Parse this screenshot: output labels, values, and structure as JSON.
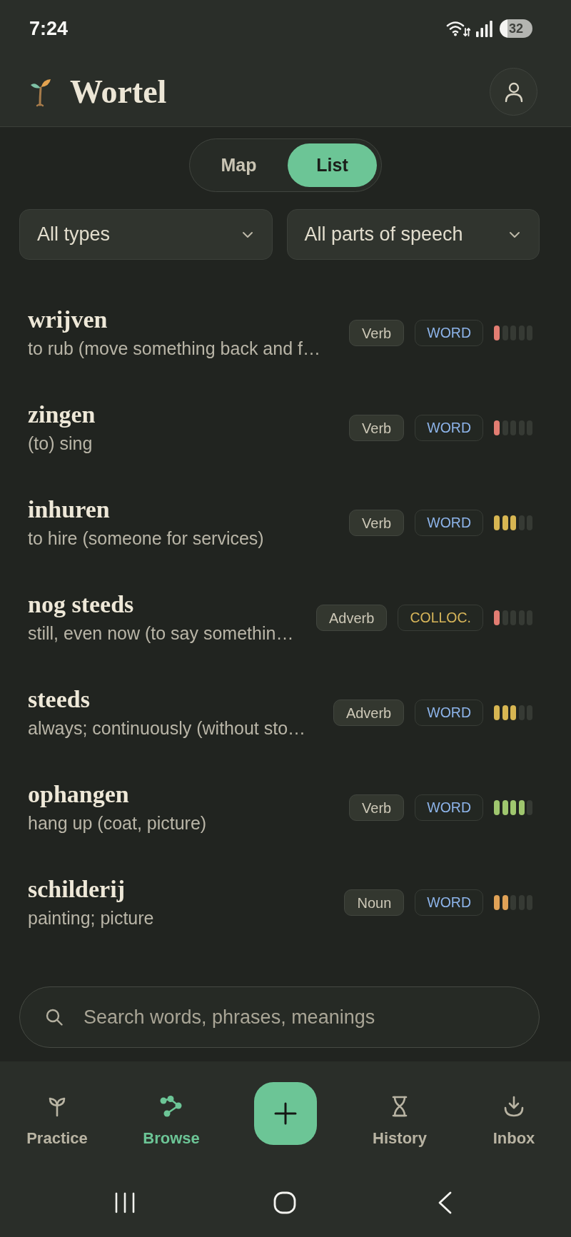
{
  "status_bar": {
    "time": "7:24",
    "battery": "32"
  },
  "header": {
    "title": "Wortel"
  },
  "view_toggle": [
    {
      "label": "Map",
      "selected": false
    },
    {
      "label": "List",
      "selected": true
    }
  ],
  "filters": [
    {
      "value": "All types"
    },
    {
      "value": "All parts of speech"
    }
  ],
  "entries": [
    {
      "word": "wrijven",
      "meaning": "to rub (move something back and f…",
      "part_of_speech": "Verb",
      "type": {
        "label": "WORD",
        "color": "#8db4ea"
      },
      "level": 0.2
    },
    {
      "word": "zingen",
      "meaning": "(to) sing",
      "part_of_speech": "Verb",
      "type": {
        "label": "WORD",
        "color": "#8db4ea"
      },
      "level": 0.2
    },
    {
      "word": "inhuren",
      "meaning": "to hire (someone for services)",
      "part_of_speech": "Verb",
      "type": {
        "label": "WORD",
        "color": "#8db4ea"
      },
      "level": 0.6
    },
    {
      "word": "nog steeds",
      "meaning": "still, even now (to say somethin…",
      "part_of_speech": "Adverb",
      "type": {
        "label": "COLLOC.",
        "color": "#d8b65a"
      },
      "level": 0.2
    },
    {
      "word": "steeds",
      "meaning": "always; continuously (without sto…",
      "part_of_speech": "Adverb",
      "type": {
        "label": "WORD",
        "color": "#8db4ea"
      },
      "level": 0.6
    },
    {
      "word": "ophangen",
      "meaning": "hang up (coat, picture)",
      "part_of_speech": "Verb",
      "type": {
        "label": "WORD",
        "color": "#8db4ea"
      },
      "level": 0.8
    },
    {
      "word": "schilderij",
      "meaning": "painting; picture",
      "part_of_speech": "Noun",
      "type": {
        "label": "WORD",
        "color": "#8db4ea"
      },
      "level": 0.4
    }
  ],
  "search": {
    "placeholder": "Search words, phrases, meanings"
  },
  "bottom_nav": [
    {
      "kind": "tab",
      "label": "Practice",
      "selected": false
    },
    {
      "kind": "tab",
      "label": "Browse",
      "selected": true
    },
    {
      "kind": "action"
    },
    {
      "kind": "tab",
      "label": "History",
      "selected": false
    },
    {
      "kind": "tab",
      "label": "Inbox",
      "selected": false
    }
  ]
}
